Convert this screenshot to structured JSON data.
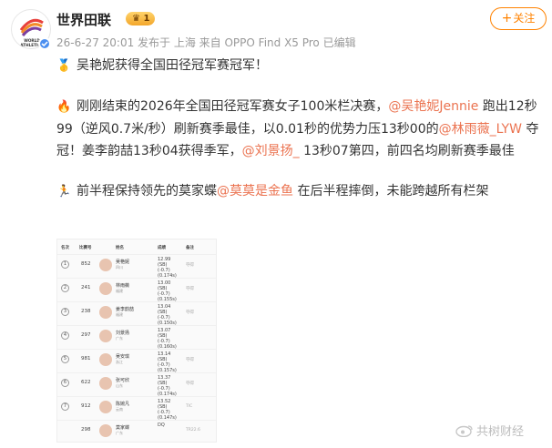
{
  "header": {
    "name": "世界田联",
    "level_badge": "1",
    "meta": "26-6-27 20:01 发布于 上海 来自 OPPO Find X5 Pro 已编辑",
    "follow_label": "关注",
    "follow_color": "#ff8200",
    "avatar_logo_text": "WORLD ATHLETICS"
  },
  "post": {
    "line1_icon": "medal-icon",
    "line1": "吴艳妮获得全国田径冠军赛冠军！",
    "p2_icon": "fire-icon",
    "p2_a": "刚刚结束的2026年全国田径冠军赛女子100米栏决赛，",
    "p2_mention1": "@吴艳妮Jennie",
    "p2_b": " 跑出12秒99（逆风0.7米/秒）刷新赛季最佳，以0.01秒的优势力压13秒00的",
    "p2_mention2": "@林雨薇_LYW",
    "p2_c": " 夺冠！姜李韵喆13秒04获得季军，",
    "p2_mention3": "@刘景扬_",
    "p2_d": " 13秒07第四，前四名均刷新赛季最佳",
    "p3_icon": "hurdler-icon",
    "p3_a": "前半程保持领先的莫家蝶",
    "p3_mention": "@莫莫是金鱼",
    "p3_b": " 在后半程摔倒，未能跨越所有栏架",
    "mention_color": "#eb7350"
  },
  "results_table": {
    "headers": [
      "名次",
      "比赛号",
      "姓名",
      "成绩",
      "备注"
    ],
    "rows": [
      {
        "rank": "1",
        "bib": "852",
        "name": "吴艳妮",
        "team": "四川",
        "result": "12.99\n(SB)\n(-0.7)\n(0.174s)",
        "note": "夺得"
      },
      {
        "rank": "2",
        "bib": "241",
        "name": "林雨薇",
        "team": "福建",
        "result": "13.00\n(SB)\n(-0.7)\n(0.155s)",
        "note": "夺得"
      },
      {
        "rank": "3",
        "bib": "238",
        "name": "姜李韵喆",
        "team": "福建",
        "result": "13.04\n(SB)\n(-0.7)\n(0.150s)",
        "note": "夺得"
      },
      {
        "rank": "4",
        "bib": "297",
        "name": "刘景扬",
        "team": "广东",
        "result": "13.07\n(SB)\n(-0.7)\n(0.160s)",
        "note": ""
      },
      {
        "rank": "5",
        "bib": "981",
        "name": "吴安琪",
        "team": "浙江",
        "result": "13.14\n(SB)\n(-0.7)\n(0.157s)",
        "note": "夺得"
      },
      {
        "rank": "6",
        "bib": "622",
        "name": "张可欣",
        "team": "山东",
        "result": "13.37\n(SB)\n(-0.7)\n(0.174s)",
        "note": "夺得"
      },
      {
        "rank": "7",
        "bib": "912",
        "name": "陈婉凡",
        "team": "云南",
        "result": "13.52\n(SB)\n(-0.7)\n(0.147s)",
        "note": "TIC"
      },
      {
        "rank": "",
        "bib": "298",
        "name": "莫家蝶",
        "team": "广东",
        "result": "DQ",
        "note": "TR22.6"
      }
    ]
  },
  "watermark": "共树财经"
}
